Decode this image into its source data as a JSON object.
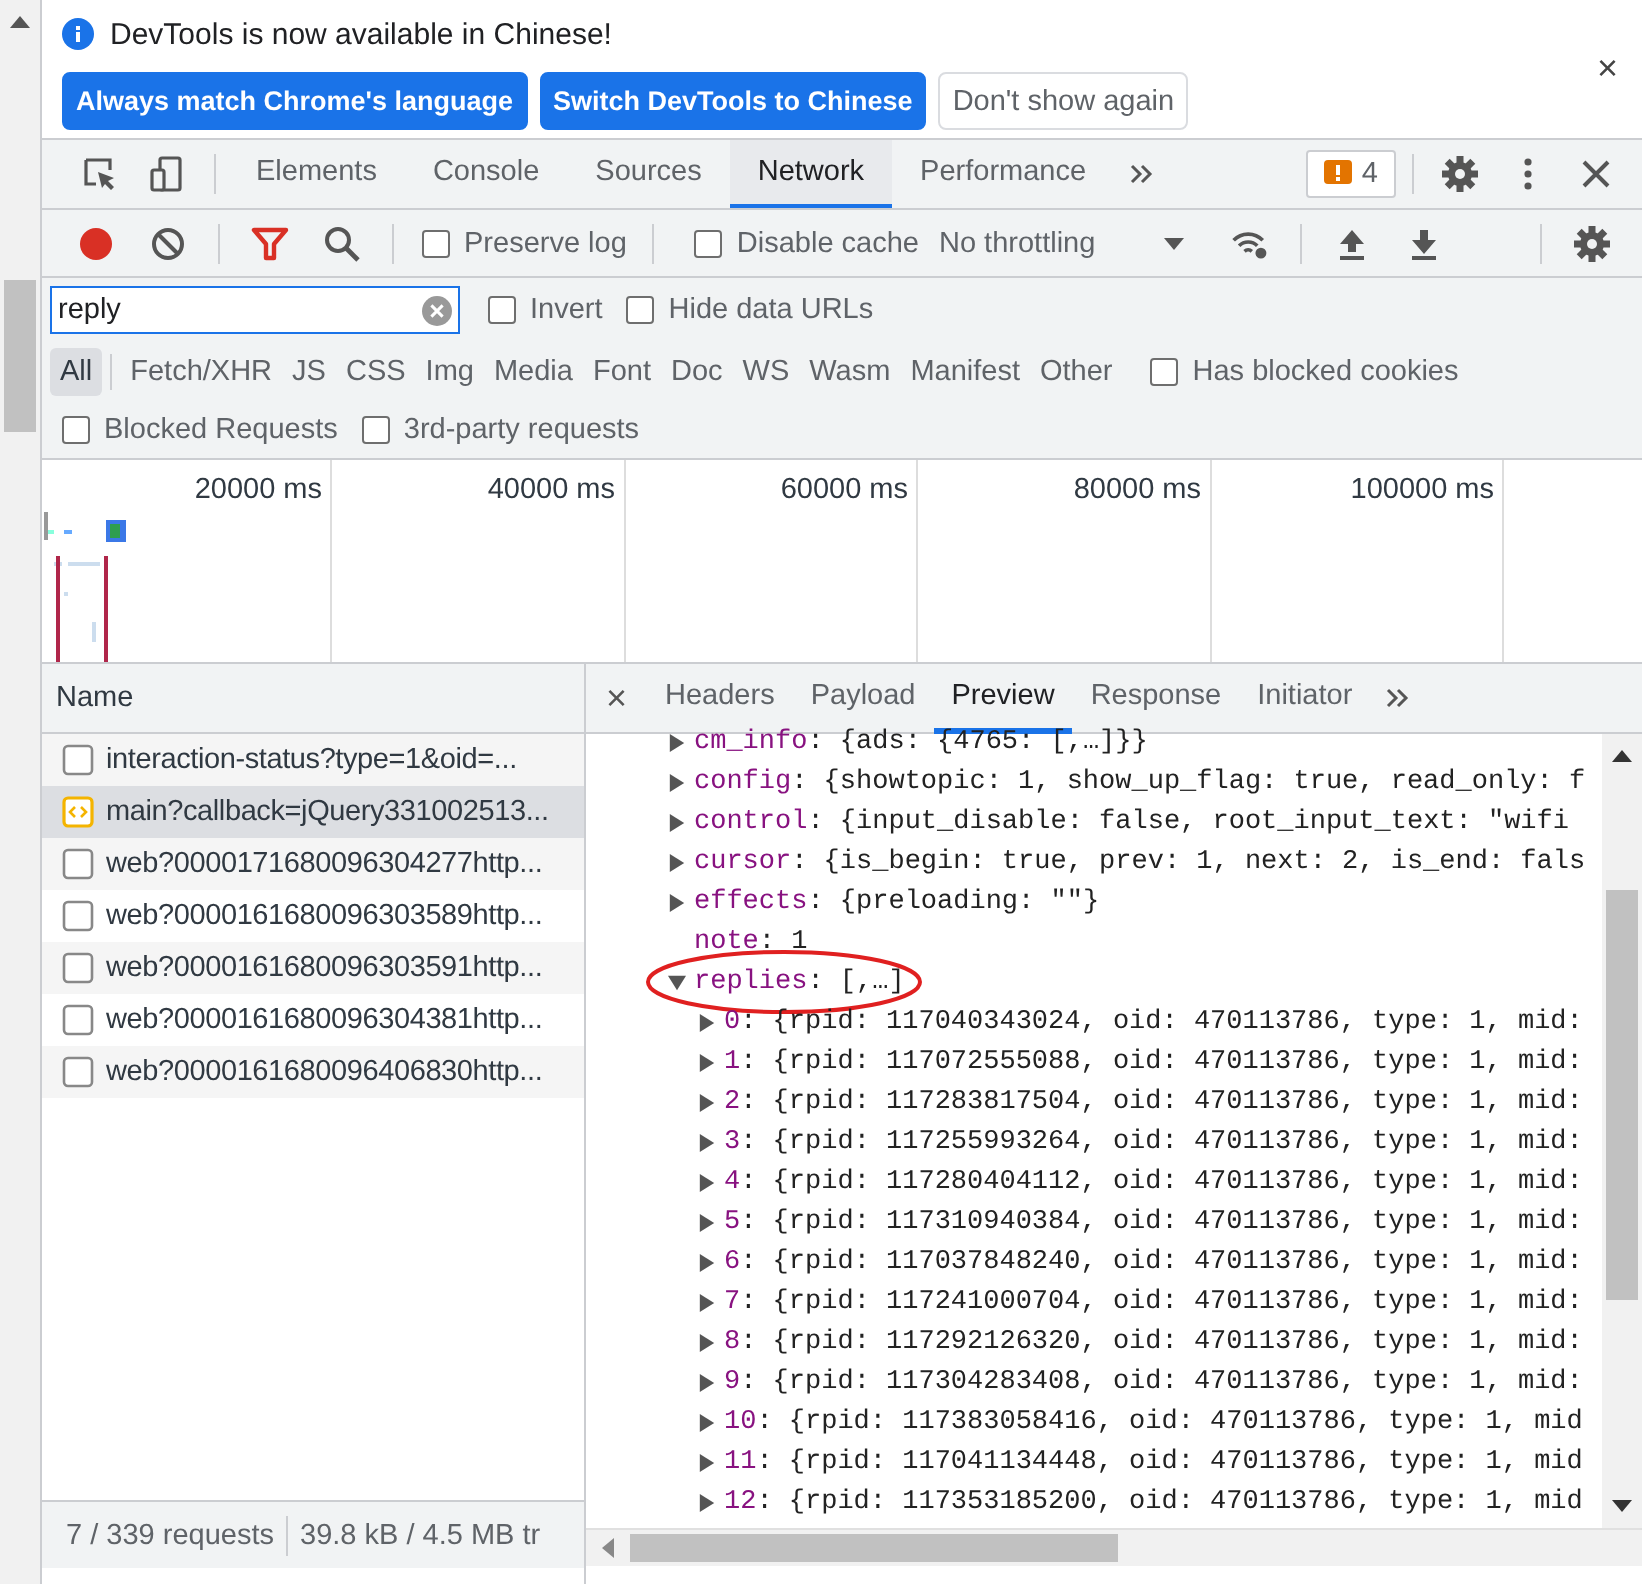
{
  "infobar": {
    "message": "DevTools is now available in Chinese!",
    "buttons": [
      {
        "label": "Always match Chrome's language",
        "primary": true
      },
      {
        "label": "Switch DevTools to Chinese",
        "primary": true
      },
      {
        "label": "Don't show again",
        "primary": false
      }
    ],
    "close": "×"
  },
  "main_tabs": [
    {
      "label": "Elements",
      "selected": false
    },
    {
      "label": "Console",
      "selected": false
    },
    {
      "label": "Sources",
      "selected": false
    },
    {
      "label": "Network",
      "selected": true
    },
    {
      "label": "Performance",
      "selected": false
    }
  ],
  "issues_badge": "4",
  "toolbar": {
    "recording": true,
    "filter_active": true,
    "checkboxes": [
      {
        "label": "Preserve log",
        "checked": false
      },
      {
        "label": "Disable cache",
        "checked": false
      }
    ],
    "throttling": "No throttling"
  },
  "filter": {
    "value": "reply",
    "checkboxes": [
      {
        "label": "Invert",
        "checked": false
      },
      {
        "label": "Hide data URLs",
        "checked": false
      }
    ]
  },
  "type_filters": [
    {
      "label": "All",
      "selected": true
    },
    {
      "label": "Fetch/XHR",
      "selected": false
    },
    {
      "label": "JS",
      "selected": false
    },
    {
      "label": "CSS",
      "selected": false
    },
    {
      "label": "Img",
      "selected": false
    },
    {
      "label": "Media",
      "selected": false
    },
    {
      "label": "Font",
      "selected": false
    },
    {
      "label": "Doc",
      "selected": false
    },
    {
      "label": "WS",
      "selected": false
    },
    {
      "label": "Wasm",
      "selected": false
    },
    {
      "label": "Manifest",
      "selected": false
    },
    {
      "label": "Other",
      "selected": false
    }
  ],
  "has_blocked_cookies": {
    "label": "Has blocked cookies",
    "checked": false
  },
  "request_filters": [
    {
      "label": "Blocked Requests",
      "checked": false
    },
    {
      "label": "3rd-party requests",
      "checked": false
    }
  ],
  "overview": {
    "time_labels": [
      "20000 ms",
      "40000 ms",
      "60000 ms",
      "80000 ms",
      "100000 ms"
    ]
  },
  "requests": {
    "column": "Name",
    "rows": [
      {
        "name": "interaction-status?type=1&oid=...",
        "kind": "document",
        "selected": false
      },
      {
        "name": "main?callback=jQuery331002513...",
        "kind": "script",
        "selected": true
      },
      {
        "name": "web?0000171680096304277http...",
        "kind": "document",
        "selected": false
      },
      {
        "name": "web?0000161680096303589http...",
        "kind": "document",
        "selected": false
      },
      {
        "name": "web?0000161680096303591http...",
        "kind": "document",
        "selected": false
      },
      {
        "name": "web?0000161680096304381http...",
        "kind": "document",
        "selected": false
      },
      {
        "name": "web?0000161680096406830http...",
        "kind": "document",
        "selected": false
      }
    ],
    "status": [
      "7 / 339 requests",
      "39.8 kB / 4.5 MB tr"
    ]
  },
  "detail": {
    "close": "×",
    "tabs": [
      {
        "label": "Headers",
        "selected": false
      },
      {
        "label": "Payload",
        "selected": false
      },
      {
        "label": "Preview",
        "selected": true
      },
      {
        "label": "Response",
        "selected": false
      },
      {
        "label": "Initiator",
        "selected": false
      }
    ],
    "preview": [
      {
        "key": "cm_info",
        "value": ": {ads: {4765: [,…]}}",
        "kind": "object",
        "expanded": false
      },
      {
        "key": "config",
        "value": ": {showtopic: 1, show_up_flag: true, read_only: f",
        "kind": "object",
        "expanded": false
      },
      {
        "key": "control",
        "value": ": {input_disable: false, root_input_text: \"wifi",
        "kind": "object",
        "expanded": false
      },
      {
        "key": "cursor",
        "value": ": {is_begin: true, prev: 1, next: 2, is_end: fals",
        "kind": "object",
        "expanded": false
      },
      {
        "key": "effects",
        "value": ": {preloading: \"\"}",
        "kind": "object",
        "expanded": false
      },
      {
        "key": "note",
        "value": ": 1",
        "kind": "leaf"
      },
      {
        "key": "replies",
        "value": ": [,…]",
        "kind": "object",
        "expanded": true,
        "circled": true,
        "children": [
          {
            "key": "0",
            "value": ": {rpid: 117040343024, oid: 470113786, type: 1, mid:",
            "kind": "object",
            "expanded": false
          },
          {
            "key": "1",
            "value": ": {rpid: 117072555088, oid: 470113786, type: 1, mid:",
            "kind": "object",
            "expanded": false
          },
          {
            "key": "2",
            "value": ": {rpid: 117283817504, oid: 470113786, type: 1, mid:",
            "kind": "object",
            "expanded": false
          },
          {
            "key": "3",
            "value": ": {rpid: 117255993264, oid: 470113786, type: 1, mid:",
            "kind": "object",
            "expanded": false
          },
          {
            "key": "4",
            "value": ": {rpid: 117280404112, oid: 470113786, type: 1, mid:",
            "kind": "object",
            "expanded": false
          },
          {
            "key": "5",
            "value": ": {rpid: 117310940384, oid: 470113786, type: 1, mid:",
            "kind": "object",
            "expanded": false
          },
          {
            "key": "6",
            "value": ": {rpid: 117037848240, oid: 470113786, type: 1, mid:",
            "kind": "object",
            "expanded": false
          },
          {
            "key": "7",
            "value": ": {rpid: 117241000704, oid: 470113786, type: 1, mid:",
            "kind": "object",
            "expanded": false
          },
          {
            "key": "8",
            "value": ": {rpid: 117292126320, oid: 470113786, type: 1, mid:",
            "kind": "object",
            "expanded": false
          },
          {
            "key": "9",
            "value": ": {rpid: 117304283408, oid: 470113786, type: 1, mid:",
            "kind": "object",
            "expanded": false
          },
          {
            "key": "10",
            "value": ": {rpid: 117383058416, oid: 470113786, type: 1, mid",
            "kind": "object",
            "expanded": false
          },
          {
            "key": "11",
            "value": ": {rpid: 117041134448, oid: 470113786, type: 1, mid",
            "kind": "object",
            "expanded": false
          },
          {
            "key": "12",
            "value": ": {rpid: 117353185200, oid: 470113786, type: 1, mid",
            "kind": "object",
            "expanded": false
          }
        ]
      }
    ]
  }
}
